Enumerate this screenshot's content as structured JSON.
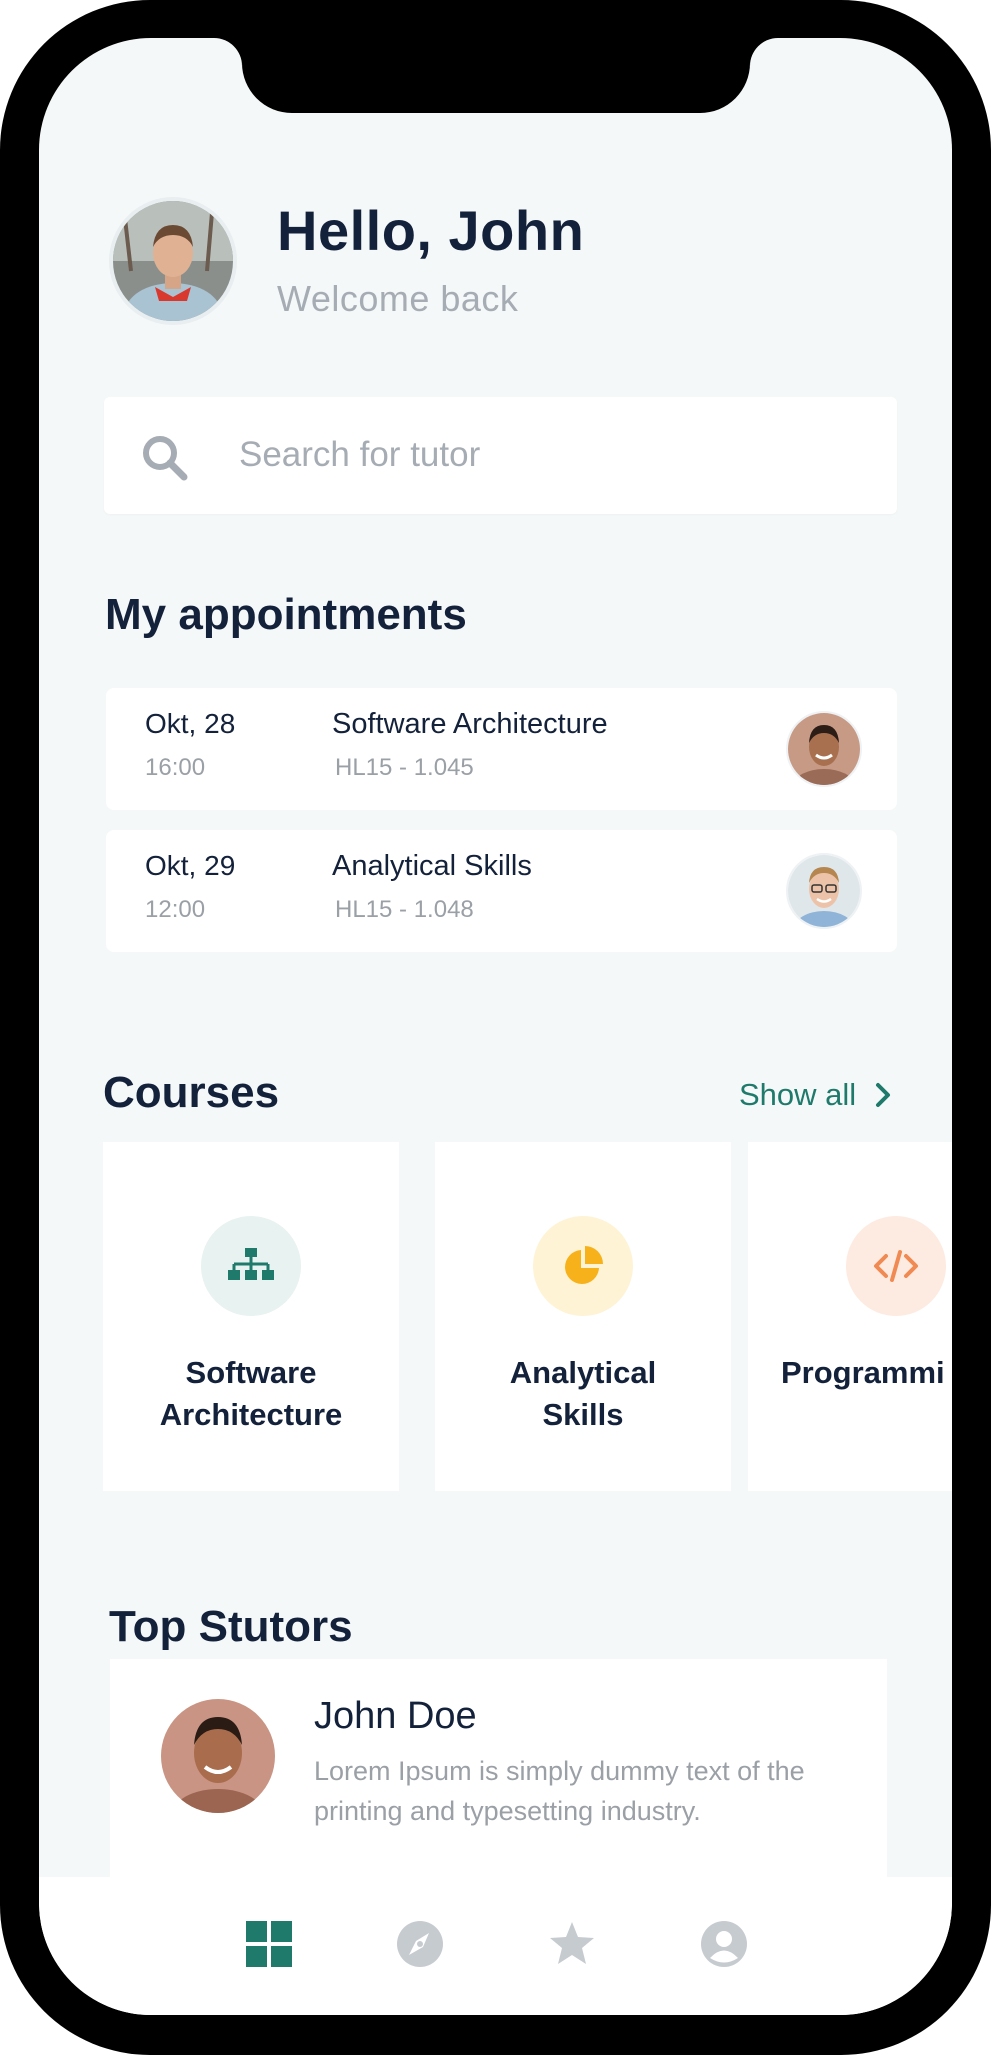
{
  "header": {
    "greeting": "Hello, John",
    "subtitle": "Welcome back",
    "avatar": "user-avatar"
  },
  "search": {
    "placeholder": "Search for tutor",
    "icon": "search-icon"
  },
  "appointments": {
    "title": "My appointments",
    "items": [
      {
        "date": "Okt, 28",
        "time": "16:00",
        "course": "Software Architecture",
        "room": "HL15 - 1.045",
        "tutor_avatar": "tutor-avatar"
      },
      {
        "date": "Okt, 29",
        "time": "12:00",
        "course": "Analytical Skills",
        "room": "HL15 - 1.048",
        "tutor_avatar": "tutor-avatar"
      }
    ]
  },
  "courses": {
    "title": "Courses",
    "show_all": "Show all",
    "items": [
      {
        "name": "Software\nArchitecture",
        "icon": "sitemap-icon",
        "color": "#1f7a6b",
        "bg": "#e8f2f0"
      },
      {
        "name": "Analytical\nSkills",
        "icon": "pie-chart-icon",
        "color": "#f7b21b",
        "bg": "#fff3d6"
      },
      {
        "name": "Programmi",
        "icon": "code-icon",
        "color": "#f08a52",
        "bg": "#fdebe1"
      }
    ]
  },
  "top_tutors": {
    "title": "Top Stutors",
    "items": [
      {
        "name": "John Doe",
        "description": "Lorem Ipsum is simply dummy text of the printing and typesetting industry."
      }
    ]
  },
  "nav": {
    "items": [
      "dashboard-icon",
      "compass-icon",
      "star-icon",
      "profile-icon"
    ],
    "active_color": "#1f7a6b",
    "inactive_color": "#c6cbd0"
  }
}
